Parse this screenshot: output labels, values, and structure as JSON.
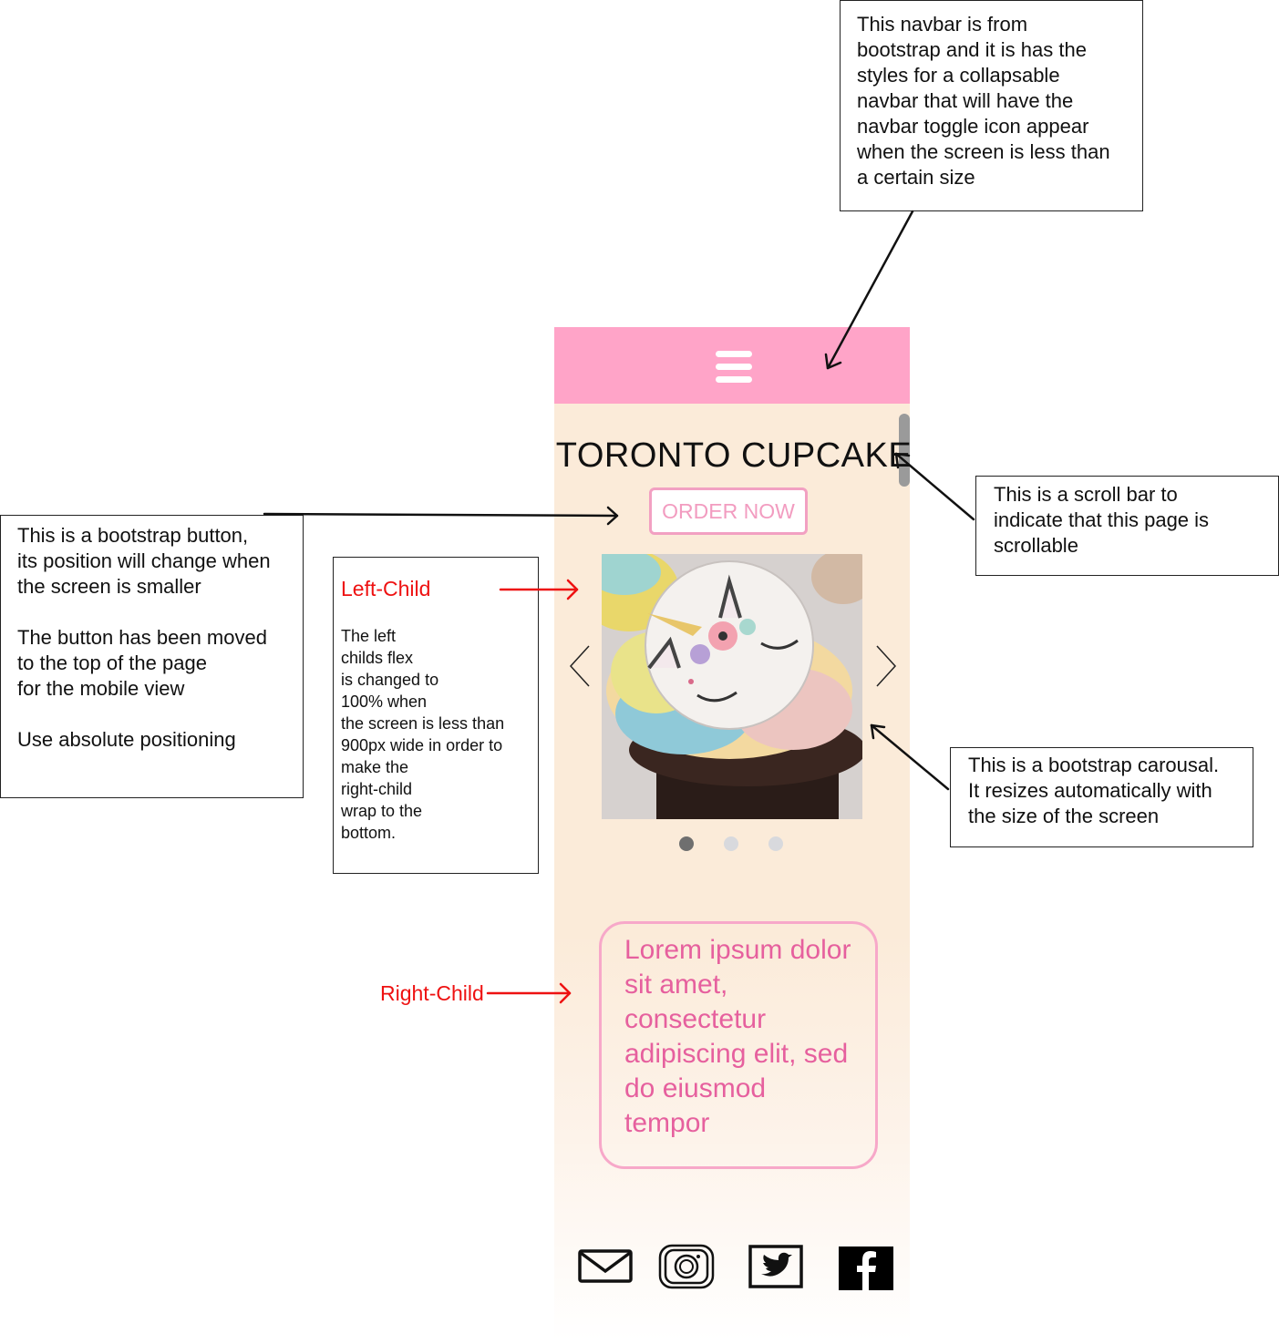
{
  "annotations": {
    "navbar_note": "This navbar is from\nbootstrap and it is has the\nstyles for a collapsable\nnavbar that will have the\nnavbar toggle icon appear\nwhen the screen is less than\na certain size",
    "button_note": "This is a bootstrap button,\nits position will change when\nthe screen is smaller\n\nThe button has been moved\nto the top of the page\nfor the mobile view\n\nUse absolute positioning",
    "scroll_note": "This is a scroll bar to\nindicate that this page is\nscrollable",
    "carousel_note": "This is a bootstrap carousal.\nIt resizes automatically with\nthe size of the screen",
    "left_child_title": "Left-Child",
    "left_child_body": "The left\nchilds flex\nis changed to\n100% when\nthe screen is less than\n900px wide in order to\nmake the\nright-child\nwrap to the\nbottom.",
    "right_child_label": "Right-Child"
  },
  "site": {
    "title": "TORONTO CUPCAKE",
    "order_button": "ORDER NOW",
    "lorem": "Lorem ipsum dolor sit amet, consectetur adipiscing elit, sed do eiusmod tempor",
    "carousel": {
      "slides": 3,
      "active_slide": 1
    }
  },
  "icons": {
    "menu": "hamburger-menu-icon",
    "prev": "chevron-left-icon",
    "next": "chevron-right-icon",
    "social": [
      "mail-icon",
      "instagram-icon",
      "twitter-icon",
      "facebook-icon"
    ]
  },
  "colors": {
    "navbar": "#ffa4c8",
    "page_background": "#fbebd9",
    "accent_pink": "#e6609e",
    "button_border": "#f2a0c2",
    "annotation_red": "#ee1111"
  }
}
